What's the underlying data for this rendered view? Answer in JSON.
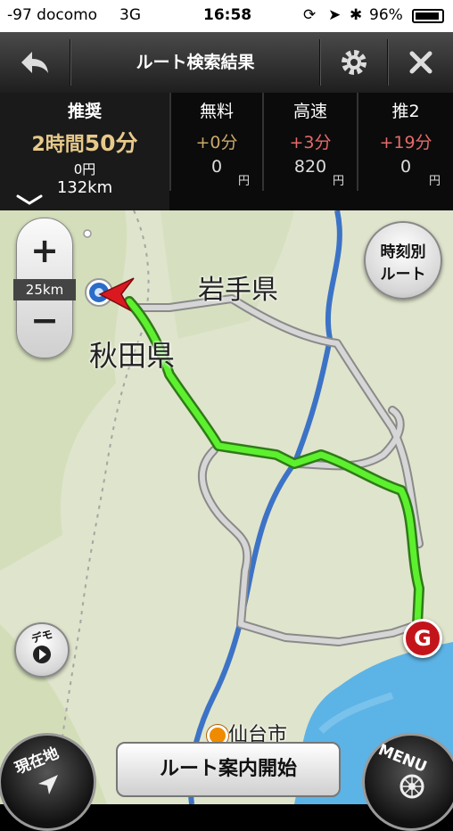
{
  "status_bar": {
    "carrier": "-97 docomo",
    "network": "3G",
    "time": "16:58",
    "battery": "96%"
  },
  "header": {
    "title": "ルート検索結果"
  },
  "routes": [
    {
      "name": "推奨",
      "time_main": "2時間",
      "time_min": "50分",
      "cost": "0円",
      "distance": "132km"
    },
    {
      "name": "無料",
      "delta": "+0分",
      "value": "0",
      "unit": "円"
    },
    {
      "name": "高速",
      "delta": "+3分",
      "value": "820",
      "unit": "円"
    },
    {
      "name": "推2",
      "delta": "+19分",
      "value": "0",
      "unit": "円"
    }
  ],
  "map": {
    "zoom_plus": "+",
    "zoom_minus": "−",
    "scale": "25km",
    "time_route_label_1": "時刻別",
    "time_route_label_2": "ルート",
    "labels": {
      "iwate": "岩手県",
      "akita": "秋田県",
      "sendai": "仙台市"
    },
    "goal_marker": "G",
    "demo_label": "デモ"
  },
  "bottom": {
    "start_label": "ルート案内開始",
    "current_label": "現在地",
    "menu_label": "MENU"
  },
  "colors": {
    "route_active": "#38d616",
    "route_other": "#b9b9b9",
    "delta_free": "#c9a86a",
    "delta_other": "#e56a6a",
    "map_land": "#dfe4cc",
    "water": "#4aa6dc"
  }
}
